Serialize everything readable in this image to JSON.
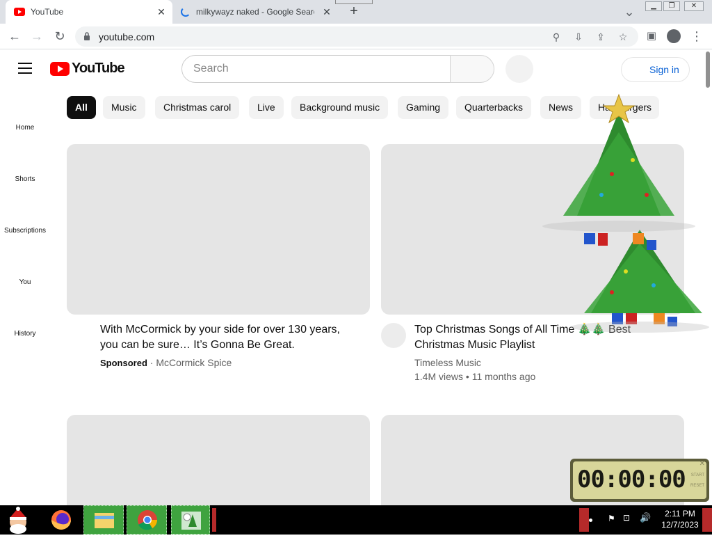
{
  "browser": {
    "tabs": [
      {
        "title": "YouTube",
        "active": true
      },
      {
        "title": "milkywayz naked - Google Search",
        "active": false
      }
    ],
    "url": "youtube.com"
  },
  "header": {
    "search_placeholder": "Search",
    "signin_label": "Sign in"
  },
  "chips": [
    "All",
    "Music",
    "Christmas carol",
    "Live",
    "Background music",
    "Gaming",
    "Quarterbacks",
    "News",
    "Hamburgers"
  ],
  "guide": [
    "Home",
    "Shorts",
    "Subscriptions",
    "You",
    "History"
  ],
  "videos": [
    {
      "title": "With McCormick by your side for over 130 years, you can be sure… It’s Gonna Be Great.",
      "sponsored": "Sponsored",
      "channel": "McCormick Spice"
    },
    {
      "title": "Top Christmas Songs of All Time 🎄🎄 Best Christmas Music Playlist",
      "channel": "Timeless Music",
      "meta": "1.4M views • 11 months ago"
    }
  ],
  "timer": {
    "display": "00:00:00",
    "start_label": "START",
    "reset_label": "RESET"
  },
  "taskbar": {
    "time": "2:11 PM",
    "date": "12/7/2023"
  }
}
